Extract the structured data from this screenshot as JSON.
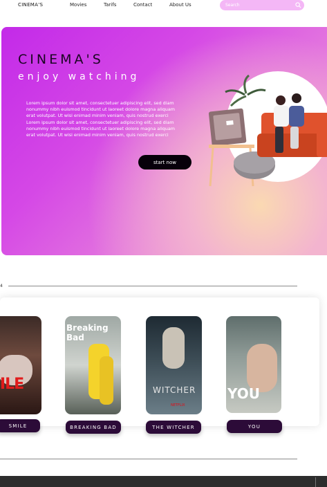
{
  "nav": {
    "brand": "CINEMA'S",
    "links": [
      "Movies",
      "Tarifs",
      "Contact",
      "About Us"
    ],
    "search_placeholder": "Search"
  },
  "hero": {
    "title": "CINEMA'S",
    "subtitle": "enjoy watching",
    "body": "Lorem ipsum dolor sit amet, consectetuer adipiscing elit, sed diam nonummy nibh euismod tincidunt ut laoreet dolore magna aliquam erat volutpat. Ut wisi enimad minim veniam, quis nostrud exerci Lorem ipsum dolor sit amet, consectetuer adipiscing elit, sed diam nonummy nibh euismod tincidunt ut laoreet dolore magna aliquam erat volutpat. Ut wisi enimad minim veniam, quis nostrud exerci",
    "button": "start now"
  },
  "section": {
    "number": "4"
  },
  "cards": [
    {
      "title": "SMILE",
      "poster_text": "MILE"
    },
    {
      "title": "BREAKING BAD",
      "poster_text": "Breaking Bad"
    },
    {
      "title": "THE WITCHER",
      "poster_text": "WITCHER"
    },
    {
      "title": "YOU",
      "poster_text": "YOU"
    }
  ],
  "colors": {
    "hero_start": "#c32ae8",
    "hero_end": "#f0b2cf",
    "search_bg": "#f4b7f6",
    "card_button": "#2c0b38",
    "bottom_bar": "#2d2d2d"
  }
}
